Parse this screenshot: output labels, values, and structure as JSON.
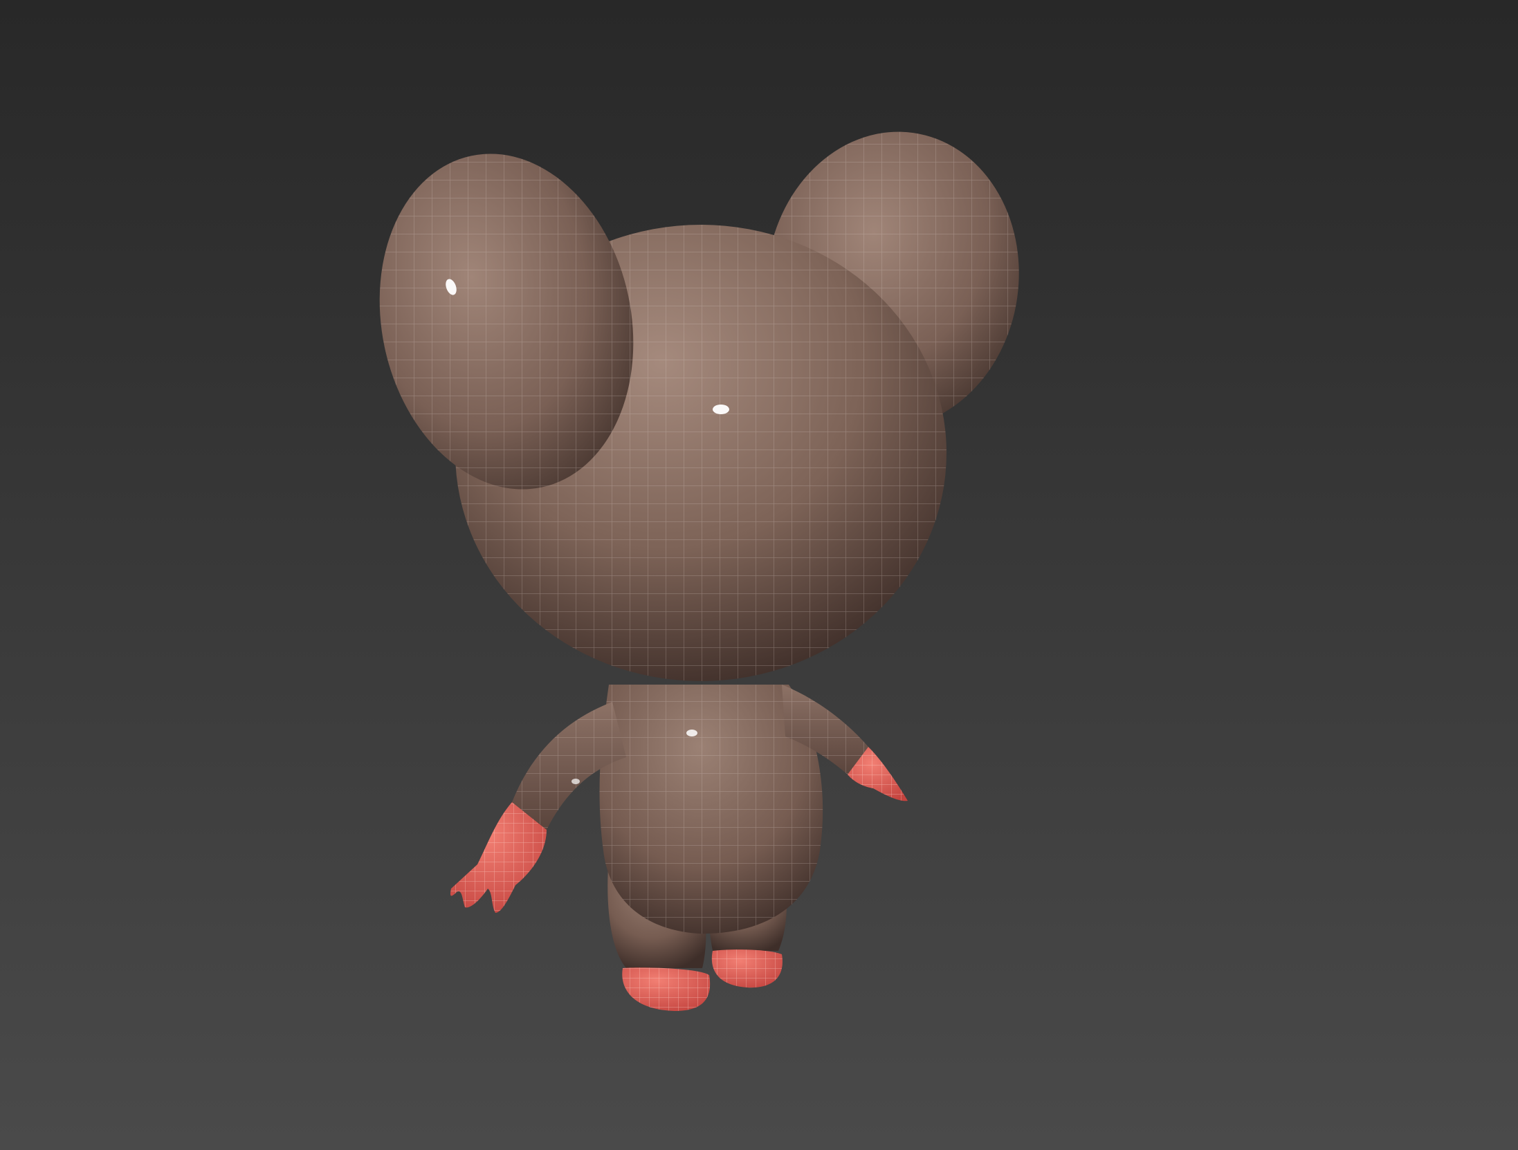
{
  "viewport": {
    "background_top": "#282828",
    "background_bottom": "#4a4a4a"
  },
  "model": {
    "body_color": "#7a6157",
    "body_highlight": "#a88b7e",
    "body_shadow": "#3f2f2a",
    "accent_color": "#e8615a",
    "wireframe_color": "#c8c0bc"
  }
}
